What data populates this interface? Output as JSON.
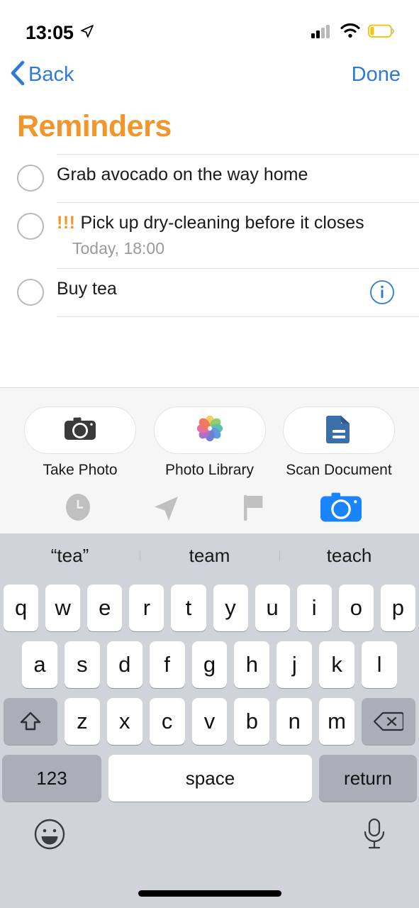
{
  "status_bar": {
    "time": "13:05",
    "location_icon": "location-arrow-icon",
    "cellular_icon": "cellular-bars-icon",
    "wifi_icon": "wifi-icon",
    "battery_icon": "battery-low-icon",
    "battery_color": "#f0c419"
  },
  "nav": {
    "back_label": "Back",
    "done_label": "Done",
    "accent_color": "#2f7bd4"
  },
  "list": {
    "title": "Reminders",
    "title_color": "#f2952b",
    "items": [
      {
        "text": "Grab avocado on the way home",
        "priority": "",
        "subtitle": "",
        "has_info": false
      },
      {
        "text": "Pick up dry-cleaning before it closes",
        "priority": "!!!",
        "subtitle": "Today, 18:00",
        "has_info": false
      },
      {
        "text": "Buy tea",
        "priority": "",
        "subtitle": "",
        "has_info": true
      }
    ]
  },
  "attachments": {
    "pills": [
      {
        "label": "Take Photo",
        "icon": "camera-icon"
      },
      {
        "label": "Photo Library",
        "icon": "photos-flower-icon"
      },
      {
        "label": "Scan Document",
        "icon": "document-scan-icon"
      }
    ],
    "quick_actions": [
      {
        "icon": "clock-icon",
        "active": false
      },
      {
        "icon": "location-arrow-icon",
        "active": false
      },
      {
        "icon": "flag-icon",
        "active": false
      },
      {
        "icon": "camera-icon",
        "active": true
      }
    ],
    "active_color": "#1a84ff"
  },
  "keyboard": {
    "suggestions": [
      "“tea”",
      "team",
      "teach"
    ],
    "row1": [
      "q",
      "w",
      "e",
      "r",
      "t",
      "y",
      "u",
      "i",
      "o",
      "p"
    ],
    "row2": [
      "a",
      "s",
      "d",
      "f",
      "g",
      "h",
      "j",
      "k",
      "l"
    ],
    "row3": [
      "z",
      "x",
      "c",
      "v",
      "b",
      "n",
      "m"
    ],
    "shift_icon": "shift-arrow-icon",
    "delete_icon": "backspace-icon",
    "numbers_label": "123",
    "space_label": "space",
    "return_label": "return",
    "emoji_icon": "emoji-smiley-icon",
    "dictation_icon": "microphone-icon"
  }
}
